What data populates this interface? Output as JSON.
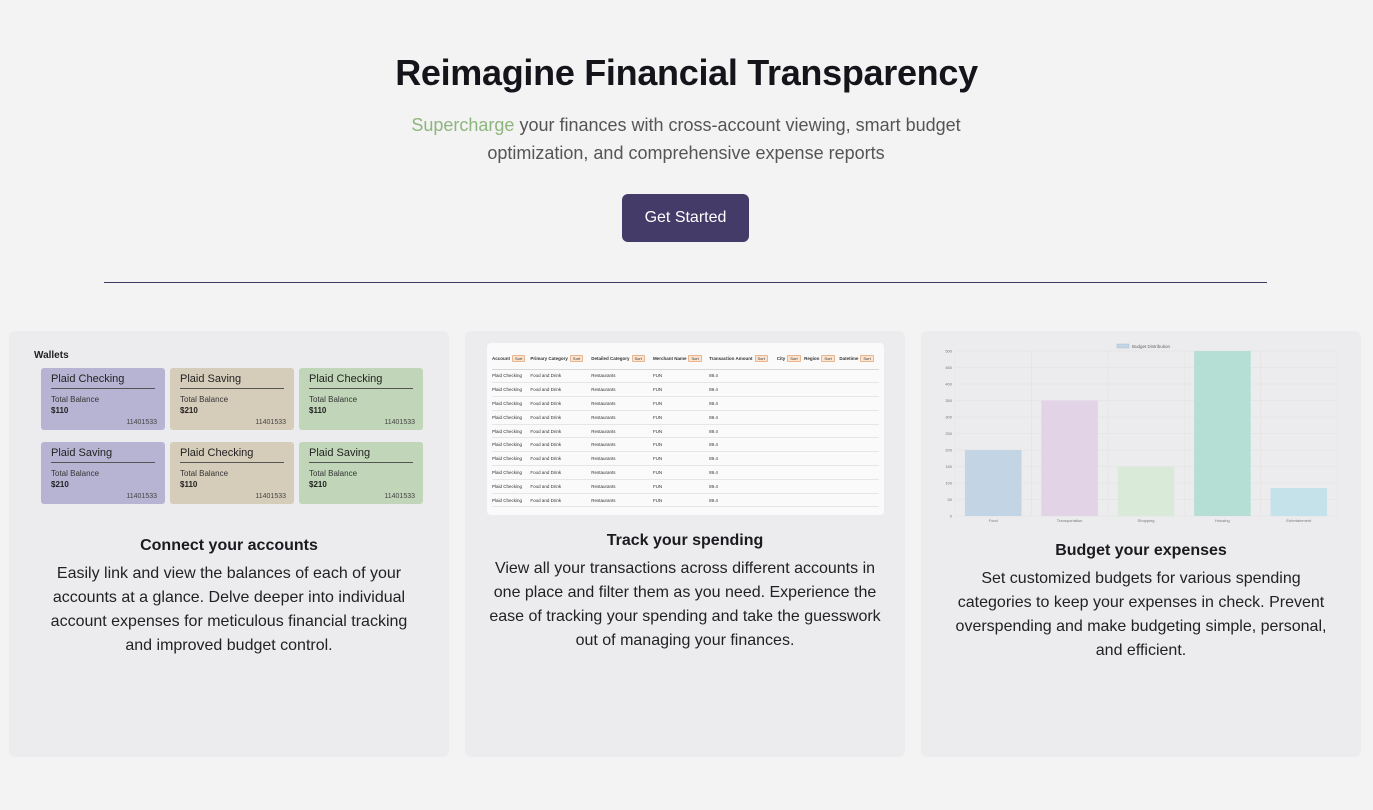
{
  "hero": {
    "title": "Reimagine Financial Transparency",
    "subtitle_accent": "Supercharge",
    "subtitle_rest": " your finances with cross-account viewing, smart budget optimization, and comprehensive expense reports",
    "cta_label": "Get Started"
  },
  "features": [
    {
      "title": "Connect your accounts",
      "description": "Easily link and view the balances of each of your accounts at a glance. Delve deeper into individual account expenses for meticulous financial tracking and improved budget control.",
      "wallets_label": "Wallets",
      "wallets": [
        {
          "name": "Plaid Checking",
          "balance_label": "Total Balance",
          "balance": "$110",
          "number": "11401533",
          "color": "#b7b4d3"
        },
        {
          "name": "Plaid Saving",
          "balance_label": "Total Balance",
          "balance": "$210",
          "number": "11401533",
          "color": "#d6ccba"
        },
        {
          "name": "Plaid Checking",
          "balance_label": "Total Balance",
          "balance": "$110",
          "number": "11401533",
          "color": "#c1d6b8"
        },
        {
          "name": "Plaid Saving",
          "balance_label": "Total Balance",
          "balance": "$210",
          "number": "11401533",
          "color": "#b7b4d3"
        },
        {
          "name": "Plaid Checking",
          "balance_label": "Total Balance",
          "balance": "$110",
          "number": "11401533",
          "color": "#d6ccba"
        },
        {
          "name": "Plaid Saving",
          "balance_label": "Total Balance",
          "balance": "$210",
          "number": "11401533",
          "color": "#c1d6b8"
        }
      ]
    },
    {
      "title": "Track your spending",
      "description": "View all your transactions across different accounts in one place and filter them as you need. Experience the ease of tracking your spending and take the guesswork out of managing your finances.",
      "table": {
        "sort_label": "Sort",
        "columns": [
          "Account",
          "Primary Category",
          "Detailed Category",
          "Merchant Name",
          "Transaction Amount",
          "City",
          "Region",
          "Datetime"
        ],
        "rows": [
          [
            "Plaid Checking",
            "Food and Drink",
            "Restaurants",
            "FUN",
            "89.4",
            "",
            "",
            ""
          ],
          [
            "Plaid Checking",
            "Food and Drink",
            "Restaurants",
            "FUN",
            "89.4",
            "",
            "",
            ""
          ],
          [
            "Plaid Checking",
            "Food and Drink",
            "Restaurants",
            "FUN",
            "89.4",
            "",
            "",
            ""
          ],
          [
            "Plaid Checking",
            "Food and Drink",
            "Restaurants",
            "FUN",
            "89.4",
            "",
            "",
            ""
          ],
          [
            "Plaid Checking",
            "Food and Drink",
            "Restaurants",
            "FUN",
            "89.4",
            "",
            "",
            ""
          ],
          [
            "Plaid Checking",
            "Food and Drink",
            "Restaurants",
            "FUN",
            "89.4",
            "",
            "",
            ""
          ],
          [
            "Plaid Checking",
            "Food and Drink",
            "Restaurants",
            "FUN",
            "89.4",
            "",
            "",
            ""
          ],
          [
            "Plaid Checking",
            "Food and Drink",
            "Restaurants",
            "FUN",
            "89.4",
            "",
            "",
            ""
          ],
          [
            "Plaid Checking",
            "Food and Drink",
            "Restaurants",
            "FUN",
            "89.4",
            "",
            "",
            ""
          ],
          [
            "Plaid Checking",
            "Food and Drink",
            "Restaurants",
            "FUN",
            "89.4",
            "",
            "",
            ""
          ]
        ]
      }
    },
    {
      "title": "Budget your expenses",
      "description": "Set customized budgets for various spending categories to keep your expenses in check. Prevent overspending and make budgeting simple, personal, and efficient."
    }
  ],
  "colors": {
    "accent": "#8db57e",
    "button": "#443b69",
    "rule": "#3c3860"
  },
  "chart_data": {
    "type": "bar",
    "legend": "Budget Distribution",
    "legend_position": "top",
    "categories": [
      "Food",
      "Transportation",
      "Shopping",
      "Housing",
      "Entertainment"
    ],
    "values": [
      200,
      350,
      150,
      500,
      85
    ],
    "colors": [
      "#c3d4e4",
      "#e3d3e6",
      "#d9ead8",
      "#b5dfd5",
      "#c5e2ea"
    ],
    "ylim": [
      0,
      500
    ],
    "yticks": [
      0,
      50,
      100,
      150,
      200,
      250,
      300,
      350,
      400,
      450,
      500
    ],
    "grid": true
  }
}
